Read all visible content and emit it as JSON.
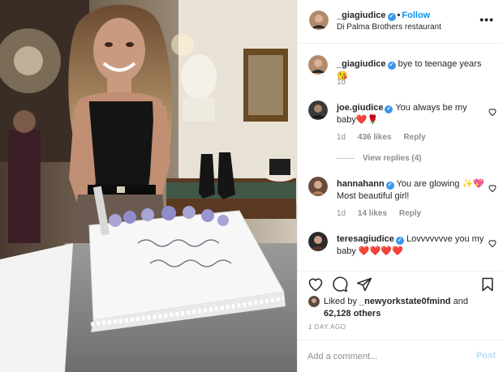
{
  "post": {
    "username": "_giagiudice",
    "follow_label": "Follow",
    "separator": "•",
    "location": "Di Palma Brothers restaurant",
    "more_label": "•••",
    "cake_text": "Happy 20 Birthday Gia! Xo"
  },
  "comments": [
    {
      "username": "_giagiudice",
      "text": "bye to teenage years 😘",
      "time": "1d"
    },
    {
      "username": "joe.giudice",
      "text": "You always be my baby❤️🌹",
      "time": "1d",
      "likes": "436 likes",
      "reply": "Reply",
      "view_replies": "View replies (4)"
    },
    {
      "username": "hannahann",
      "text": "You are glowing ✨💖 Most beautiful girl!",
      "time": "1d",
      "likes": "14 likes",
      "reply": "Reply"
    },
    {
      "username": "teresagiudice",
      "text": "Lovvvvvvve you my baby ❤️❤️❤️❤️"
    }
  ],
  "likes": {
    "prefix": "Liked by",
    "user": "_newyorkstate0fmind",
    "and": "and",
    "count": "62,128 others"
  },
  "timestamp": "1 DAY AGO",
  "composer": {
    "placeholder": "Add a comment...",
    "post_label": "Post"
  },
  "icons": {
    "verified": "verified-check-icon",
    "like": "heart-icon",
    "comment": "comment-bubble-icon",
    "share": "paper-plane-icon",
    "save": "bookmark-icon"
  },
  "colors": {
    "link_blue": "#0095f6",
    "verified_blue": "#3897f0",
    "secondary_text": "#8e8e8e",
    "post_disabled": "#b2dffc"
  }
}
